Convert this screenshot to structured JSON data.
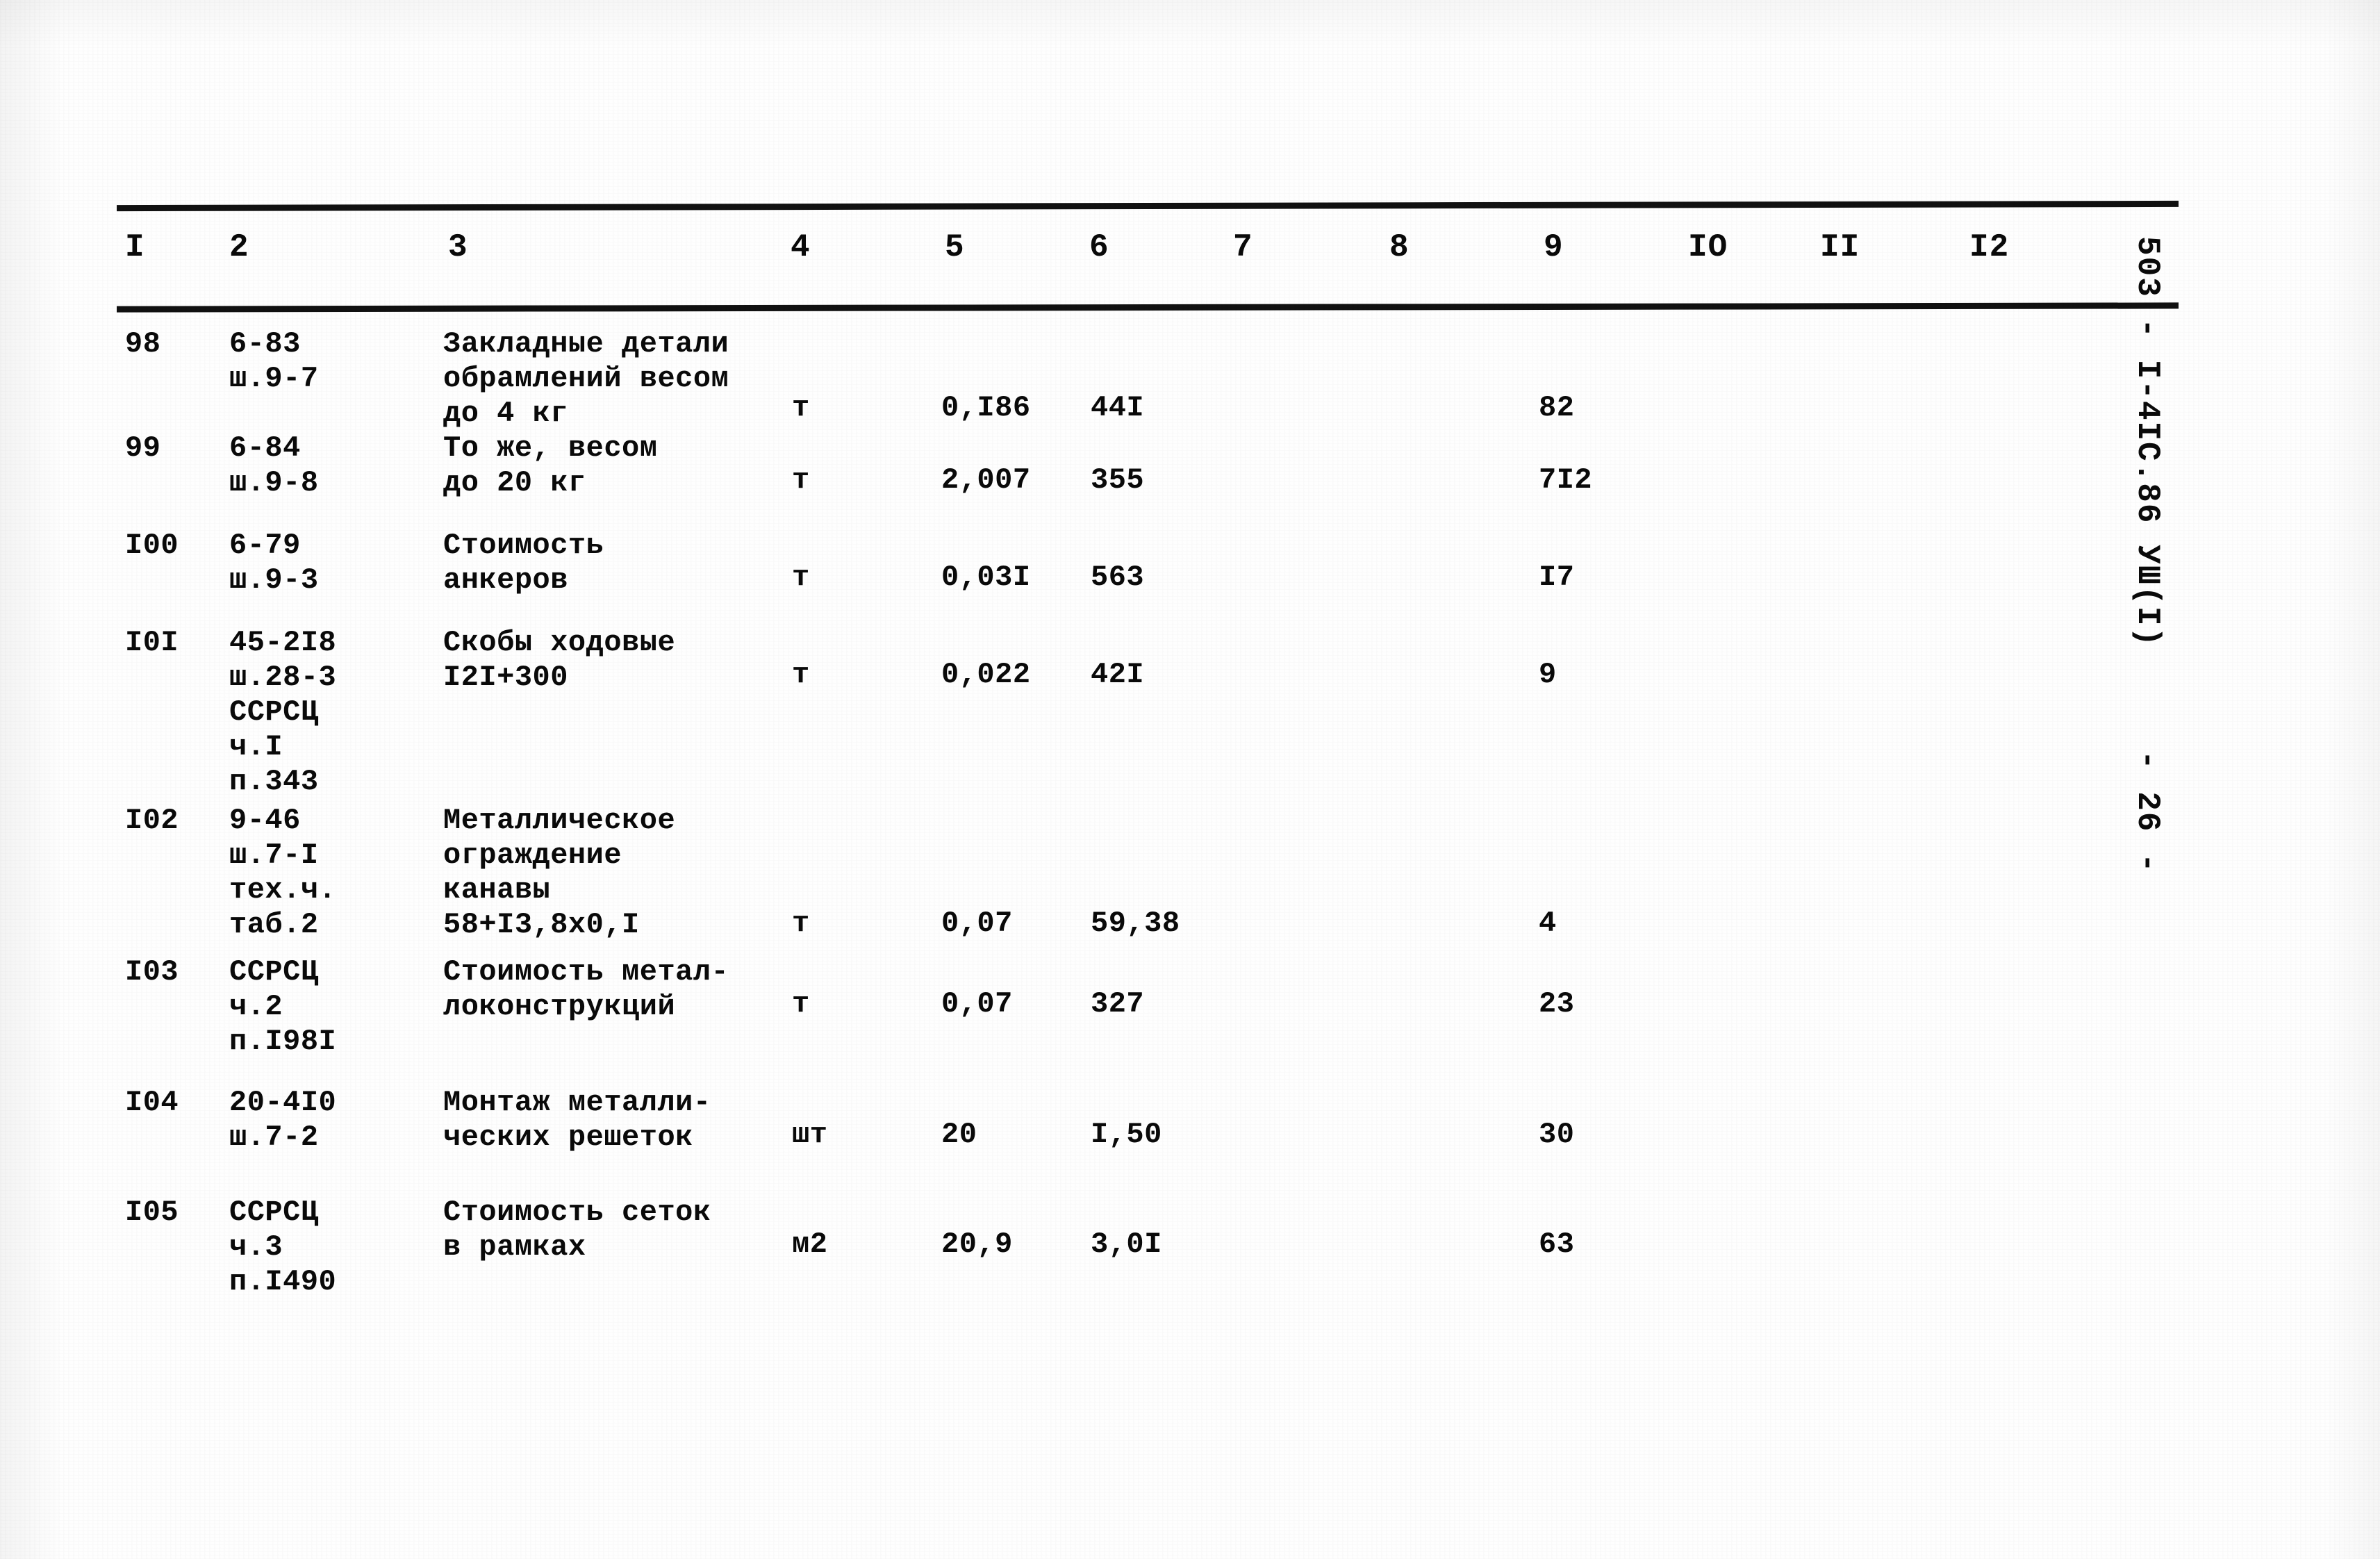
{
  "document": {
    "vertical_caption": "503 - I-4IC.86 УШ(I)     - 26 -"
  },
  "table": {
    "column_headers": [
      "I",
      "2",
      "3",
      "4",
      "5",
      "6",
      "7",
      "8",
      "9",
      "IO",
      "II",
      "I2"
    ],
    "rows": [
      {
        "no": "98",
        "code": "6-83\nш.9-7",
        "description": "Закладные детали\nобрамлений весом\nдо 4 кг",
        "unit": "т",
        "qty": "0,I86",
        "price": "44I",
        "c7": "",
        "c8": "",
        "total": "82",
        "c10": "",
        "c11": "",
        "c12": ""
      },
      {
        "no": "99",
        "code": "6-84\nш.9-8",
        "description": "То же, весом\nдо 20 кг",
        "unit": "т",
        "qty": "2,007",
        "price": "355",
        "c7": "",
        "c8": "",
        "total": "7I2",
        "c10": "",
        "c11": "",
        "c12": ""
      },
      {
        "no": "I00",
        "code": "6-79\nш.9-3",
        "description": "Стоимость\nанкеров",
        "unit": "т",
        "qty": "0,03I",
        "price": "563",
        "c7": "",
        "c8": "",
        "total": "I7",
        "c10": "",
        "c11": "",
        "c12": ""
      },
      {
        "no": "I0I",
        "code": "45-2I8\nш.28-3\nССРСЦ\nч.I\nп.343",
        "description": "Скобы ходовые\nI2I+300",
        "unit": "т",
        "qty": "0,022",
        "price": "42I",
        "c7": "",
        "c8": "",
        "total": "9",
        "c10": "",
        "c11": "",
        "c12": ""
      },
      {
        "no": "I02",
        "code": "9-46\nш.7-I\nтех.ч.\nтаб.2",
        "description": "Металлическое\nограждение\nканавы\n58+I3,8х0,I",
        "unit": "т",
        "qty": "0,07",
        "price": "59,38",
        "c7": "",
        "c8": "",
        "total": "4",
        "c10": "",
        "c11": "",
        "c12": ""
      },
      {
        "no": "I03",
        "code": "ССРСЦ\nч.2\nп.I98I",
        "description": "Стоимость метал-\nлоконструкций",
        "unit": "т",
        "qty": "0,07",
        "price": "327",
        "c7": "",
        "c8": "",
        "total": "23",
        "c10": "",
        "c11": "",
        "c12": ""
      },
      {
        "no": "I04",
        "code": "20-4I0\nш.7-2",
        "description": "Монтаж металли-\nческих решеток",
        "unit": "шт",
        "qty": "20",
        "price": "I,50",
        "c7": "",
        "c8": "",
        "total": "30",
        "c10": "",
        "c11": "",
        "c12": ""
      },
      {
        "no": "I05",
        "code": "ССРСЦ\nч.3\nп.I490",
        "description": "Стоимость сеток\nв рамках",
        "unit": "м2",
        "qty": "20,9",
        "price": "3,0I",
        "c7": "",
        "c8": "",
        "total": "63",
        "c10": "",
        "c11": "",
        "c12": ""
      }
    ]
  }
}
